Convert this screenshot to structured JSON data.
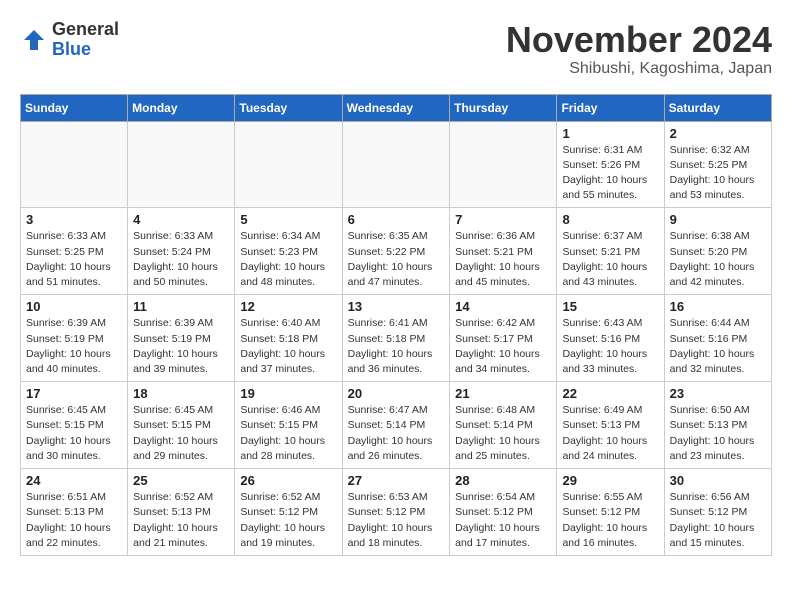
{
  "logo": {
    "general": "General",
    "blue": "Blue"
  },
  "title": "November 2024",
  "location": "Shibushi, Kagoshima, Japan",
  "weekdays": [
    "Sunday",
    "Monday",
    "Tuesday",
    "Wednesday",
    "Thursday",
    "Friday",
    "Saturday"
  ],
  "weeks": [
    [
      {
        "day": "",
        "info": ""
      },
      {
        "day": "",
        "info": ""
      },
      {
        "day": "",
        "info": ""
      },
      {
        "day": "",
        "info": ""
      },
      {
        "day": "",
        "info": ""
      },
      {
        "day": "1",
        "info": "Sunrise: 6:31 AM\nSunset: 5:26 PM\nDaylight: 10 hours\nand 55 minutes."
      },
      {
        "day": "2",
        "info": "Sunrise: 6:32 AM\nSunset: 5:25 PM\nDaylight: 10 hours\nand 53 minutes."
      }
    ],
    [
      {
        "day": "3",
        "info": "Sunrise: 6:33 AM\nSunset: 5:25 PM\nDaylight: 10 hours\nand 51 minutes."
      },
      {
        "day": "4",
        "info": "Sunrise: 6:33 AM\nSunset: 5:24 PM\nDaylight: 10 hours\nand 50 minutes."
      },
      {
        "day": "5",
        "info": "Sunrise: 6:34 AM\nSunset: 5:23 PM\nDaylight: 10 hours\nand 48 minutes."
      },
      {
        "day": "6",
        "info": "Sunrise: 6:35 AM\nSunset: 5:22 PM\nDaylight: 10 hours\nand 47 minutes."
      },
      {
        "day": "7",
        "info": "Sunrise: 6:36 AM\nSunset: 5:21 PM\nDaylight: 10 hours\nand 45 minutes."
      },
      {
        "day": "8",
        "info": "Sunrise: 6:37 AM\nSunset: 5:21 PM\nDaylight: 10 hours\nand 43 minutes."
      },
      {
        "day": "9",
        "info": "Sunrise: 6:38 AM\nSunset: 5:20 PM\nDaylight: 10 hours\nand 42 minutes."
      }
    ],
    [
      {
        "day": "10",
        "info": "Sunrise: 6:39 AM\nSunset: 5:19 PM\nDaylight: 10 hours\nand 40 minutes."
      },
      {
        "day": "11",
        "info": "Sunrise: 6:39 AM\nSunset: 5:19 PM\nDaylight: 10 hours\nand 39 minutes."
      },
      {
        "day": "12",
        "info": "Sunrise: 6:40 AM\nSunset: 5:18 PM\nDaylight: 10 hours\nand 37 minutes."
      },
      {
        "day": "13",
        "info": "Sunrise: 6:41 AM\nSunset: 5:18 PM\nDaylight: 10 hours\nand 36 minutes."
      },
      {
        "day": "14",
        "info": "Sunrise: 6:42 AM\nSunset: 5:17 PM\nDaylight: 10 hours\nand 34 minutes."
      },
      {
        "day": "15",
        "info": "Sunrise: 6:43 AM\nSunset: 5:16 PM\nDaylight: 10 hours\nand 33 minutes."
      },
      {
        "day": "16",
        "info": "Sunrise: 6:44 AM\nSunset: 5:16 PM\nDaylight: 10 hours\nand 32 minutes."
      }
    ],
    [
      {
        "day": "17",
        "info": "Sunrise: 6:45 AM\nSunset: 5:15 PM\nDaylight: 10 hours\nand 30 minutes."
      },
      {
        "day": "18",
        "info": "Sunrise: 6:45 AM\nSunset: 5:15 PM\nDaylight: 10 hours\nand 29 minutes."
      },
      {
        "day": "19",
        "info": "Sunrise: 6:46 AM\nSunset: 5:15 PM\nDaylight: 10 hours\nand 28 minutes."
      },
      {
        "day": "20",
        "info": "Sunrise: 6:47 AM\nSunset: 5:14 PM\nDaylight: 10 hours\nand 26 minutes."
      },
      {
        "day": "21",
        "info": "Sunrise: 6:48 AM\nSunset: 5:14 PM\nDaylight: 10 hours\nand 25 minutes."
      },
      {
        "day": "22",
        "info": "Sunrise: 6:49 AM\nSunset: 5:13 PM\nDaylight: 10 hours\nand 24 minutes."
      },
      {
        "day": "23",
        "info": "Sunrise: 6:50 AM\nSunset: 5:13 PM\nDaylight: 10 hours\nand 23 minutes."
      }
    ],
    [
      {
        "day": "24",
        "info": "Sunrise: 6:51 AM\nSunset: 5:13 PM\nDaylight: 10 hours\nand 22 minutes."
      },
      {
        "day": "25",
        "info": "Sunrise: 6:52 AM\nSunset: 5:13 PM\nDaylight: 10 hours\nand 21 minutes."
      },
      {
        "day": "26",
        "info": "Sunrise: 6:52 AM\nSunset: 5:12 PM\nDaylight: 10 hours\nand 19 minutes."
      },
      {
        "day": "27",
        "info": "Sunrise: 6:53 AM\nSunset: 5:12 PM\nDaylight: 10 hours\nand 18 minutes."
      },
      {
        "day": "28",
        "info": "Sunrise: 6:54 AM\nSunset: 5:12 PM\nDaylight: 10 hours\nand 17 minutes."
      },
      {
        "day": "29",
        "info": "Sunrise: 6:55 AM\nSunset: 5:12 PM\nDaylight: 10 hours\nand 16 minutes."
      },
      {
        "day": "30",
        "info": "Sunrise: 6:56 AM\nSunset: 5:12 PM\nDaylight: 10 hours\nand 15 minutes."
      }
    ]
  ]
}
